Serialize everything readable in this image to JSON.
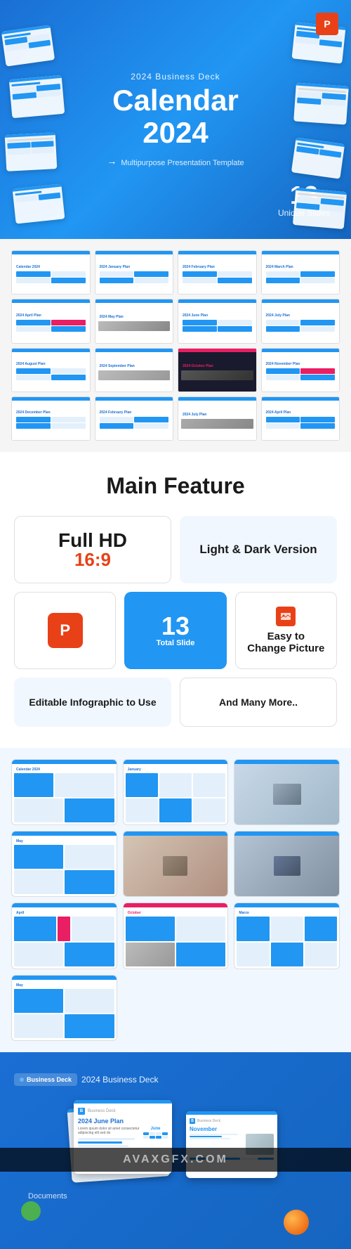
{
  "hero": {
    "subtitle": "2024 Business Deck",
    "title": "Calendar\n2024",
    "tagline": "Multipurpose Presentation Template",
    "badge_num": "13",
    "badge_label": "Unique Slides",
    "ppt_icon": "P"
  },
  "slide_grid": {
    "slides": [
      {
        "label": "Calendar 2024",
        "type": "calendar"
      },
      {
        "label": "2024 January Plan",
        "type": "plan"
      },
      {
        "label": "2024 February Plan",
        "type": "plan"
      },
      {
        "label": "2024 March Plan",
        "type": "plan"
      },
      {
        "label": "2024 April Plan",
        "type": "plan"
      },
      {
        "label": "2024 May Plan",
        "type": "plan"
      },
      {
        "label": "2024 June Plan",
        "type": "plan"
      },
      {
        "label": "2024 July Plan",
        "type": "plan"
      },
      {
        "label": "2024 August Plan",
        "type": "plan"
      },
      {
        "label": "2024 September Plan",
        "type": "plan"
      },
      {
        "label": "2024 October Plan",
        "type": "dark"
      },
      {
        "label": "2024 November Plan",
        "type": "plan"
      },
      {
        "label": "2024 December Plan",
        "type": "plan"
      },
      {
        "label": "2024 February Plan",
        "type": "plan"
      },
      {
        "label": "2024 July Plan",
        "type": "plan"
      },
      {
        "label": "2024 April Plan",
        "type": "plan"
      }
    ]
  },
  "main_feature": {
    "title": "Main Feature",
    "features": [
      {
        "id": "fullhd",
        "line1": "Full HD",
        "line2": "16:9"
      },
      {
        "id": "lightdark",
        "text": "Light & Dark Version"
      },
      {
        "id": "ppt",
        "icon": "P"
      },
      {
        "id": "slides13",
        "num": "13",
        "label": "Total Slide"
      },
      {
        "id": "picture",
        "text": "Easy to Change Picture"
      },
      {
        "id": "infographic",
        "text": "Editable Infographic to Use"
      },
      {
        "id": "more",
        "text": "And Many More.."
      }
    ]
  },
  "preview": {
    "cards": [
      {
        "title": "Calendar 2024",
        "type": "main"
      },
      {
        "title": "January",
        "type": "calendar"
      },
      {
        "title": "",
        "type": "photo"
      },
      {
        "title": "May",
        "type": "calendar"
      },
      {
        "title": "",
        "type": "photo2"
      },
      {
        "title": "",
        "type": "photo3"
      },
      {
        "title": "April",
        "type": "calendar"
      },
      {
        "title": "October",
        "type": "calendar"
      },
      {
        "title": "Marzo",
        "type": "calendar"
      },
      {
        "title": "May",
        "type": "calendar"
      }
    ]
  },
  "bottom": {
    "label": "2024 Business Deck",
    "card1_title": "2024 June Plan",
    "card1_month": "June",
    "card2_title": "November",
    "deck_logo": "Business Deck",
    "documents_label": "Documents"
  },
  "watermark": {
    "text": "AVAXGFX.COM"
  }
}
